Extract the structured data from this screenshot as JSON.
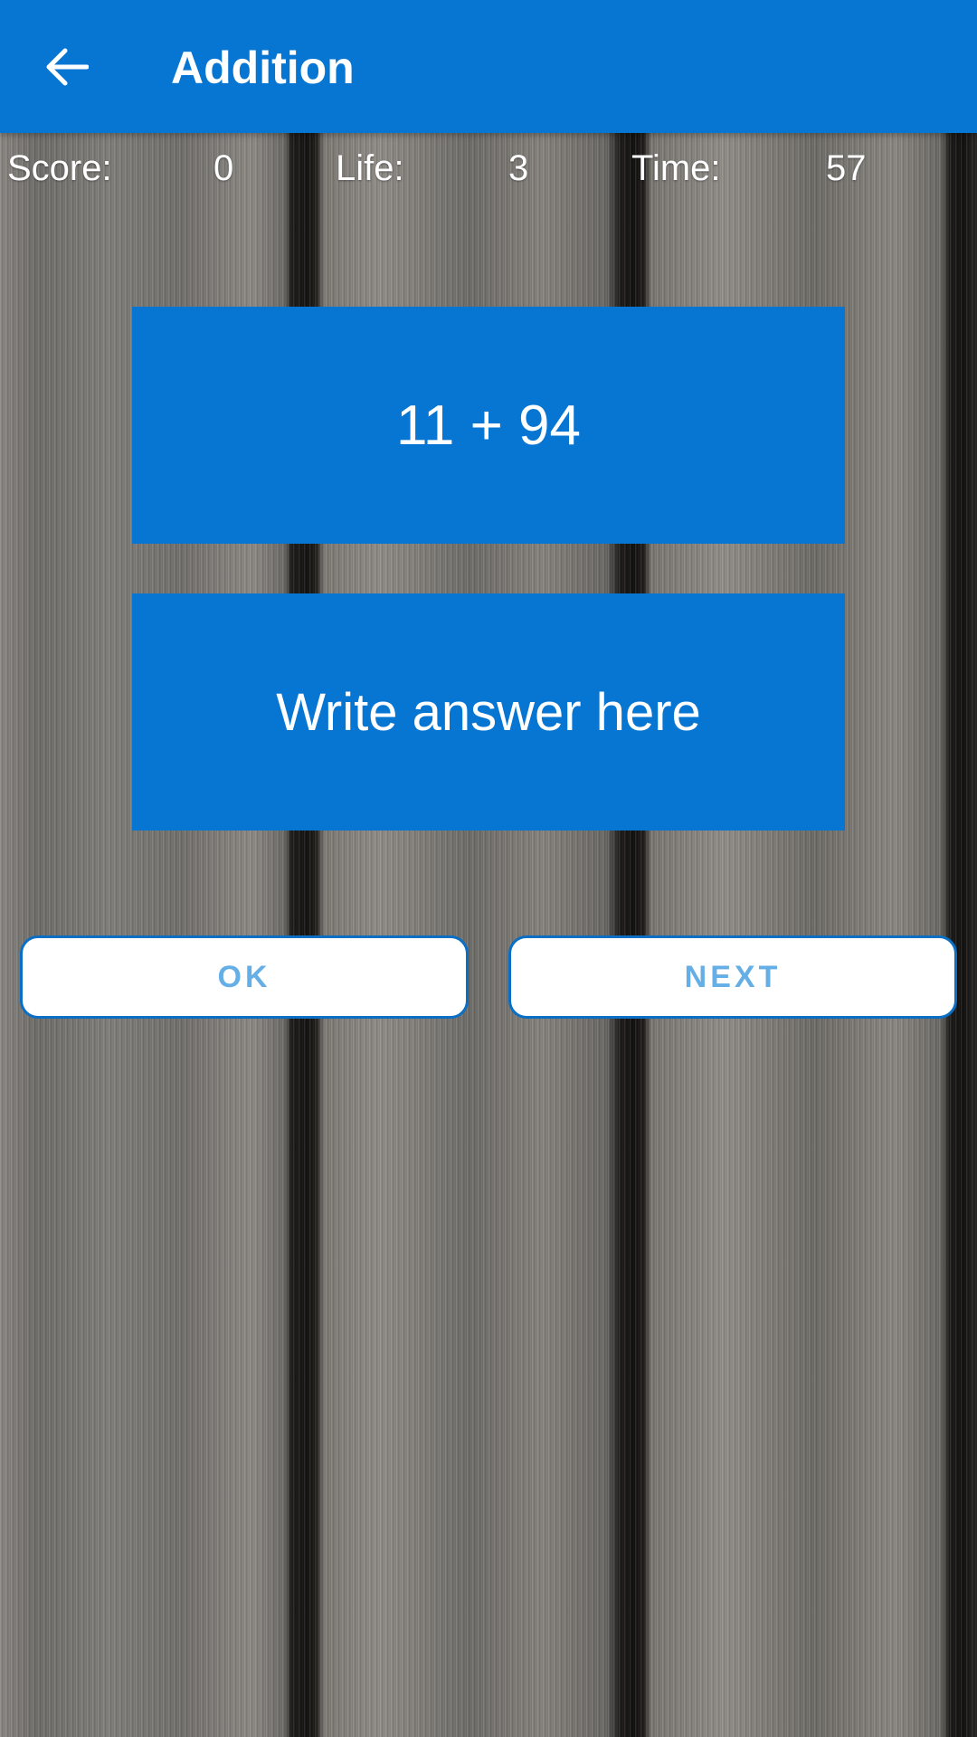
{
  "app_bar": {
    "title": "Addition",
    "back_icon": "arrow-left-icon",
    "background": "#0776d3"
  },
  "stats": {
    "score_label": "Score:",
    "score_value": "0",
    "life_label": "Life:",
    "life_value": "3",
    "time_label": "Time:",
    "time_value": "57"
  },
  "question": {
    "text": "11 + 94"
  },
  "answer": {
    "value": "",
    "placeholder": "Write answer here"
  },
  "buttons": {
    "ok_label": "OK",
    "next_label": "NEXT"
  },
  "colors": {
    "accent": "#0776d3",
    "button_text": "#66aee6",
    "button_border": "#0a6fc4"
  }
}
